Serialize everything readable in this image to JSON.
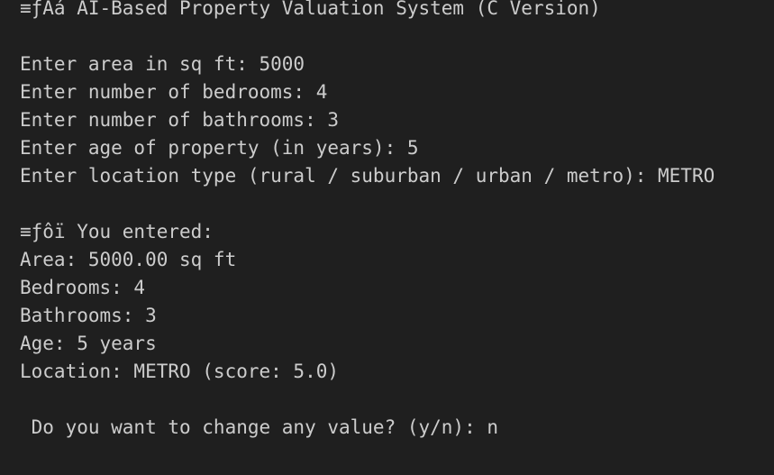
{
  "colors": {
    "background": "#1f1f1f",
    "text": "#cccccc"
  },
  "terminal": {
    "lines": [
      "≡ƒAá AI-Based Property Valuation System (C Version)",
      "",
      "Enter area in sq ft: 5000",
      "Enter number of bedrooms: 4",
      "Enter number of bathrooms: 3",
      "Enter age of property (in years): 5",
      "Enter location type (rural / suburban / urban / metro): METRO",
      "",
      "≡ƒôï You entered:",
      "Area: 5000.00 sq ft",
      "Bedrooms: 4",
      "Bathrooms: 3",
      "Age: 5 years",
      "Location: METRO (score: 5.0)",
      "",
      " Do you want to change any value? (y/n): n"
    ]
  }
}
